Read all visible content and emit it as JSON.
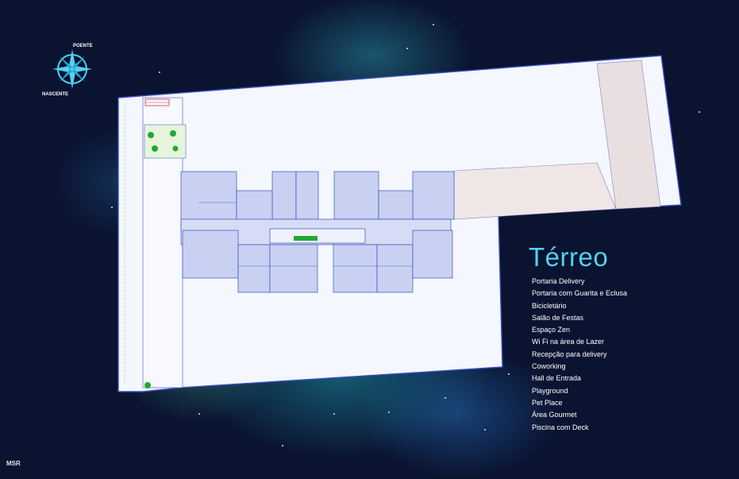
{
  "title": "Térreo",
  "amenities": [
    "Portaria Delivery",
    "Portaria com Guarita e Eclusa",
    "Bicicletário",
    "Salão de Festas",
    "Espaço Zen",
    "Wi Fi na área de Lazer",
    "Recepção para delivery",
    "Coworking",
    "Hall de Entrada",
    "Playground",
    "Pet Place",
    "Área Gourmet",
    "Piscina com Deck"
  ],
  "compass": {
    "north_label": "POENTE",
    "south_label": "NASCENTE",
    "icon": "compass-rose-icon"
  },
  "brand": "MSR",
  "colors": {
    "title": "#4fd3f0",
    "background": "#0a1330",
    "plan_line": "#3b4fc0",
    "plan_fill": "#f4f7fe"
  }
}
